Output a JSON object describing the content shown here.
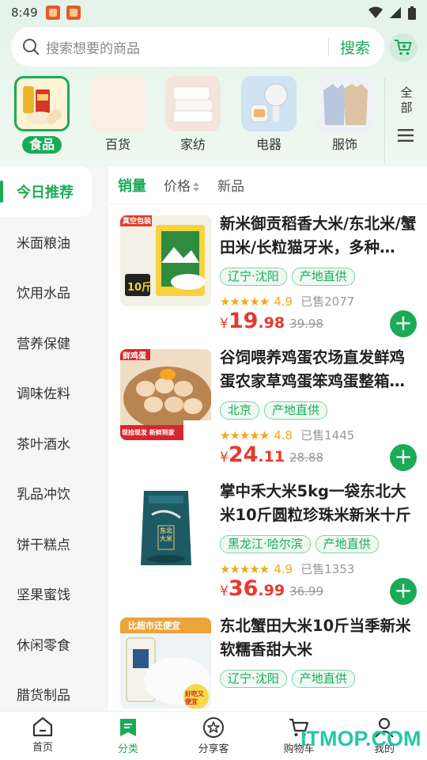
{
  "status_bar": {
    "time": "8:49"
  },
  "search": {
    "placeholder": "搜索想要的商品",
    "button": "搜索"
  },
  "categories": [
    {
      "label": "食品",
      "icon": "food-icon",
      "active": true
    },
    {
      "label": "百货",
      "icon": "goods-icon"
    },
    {
      "label": "家纺",
      "icon": "textile-icon"
    },
    {
      "label": "电器",
      "icon": "appliance-icon"
    },
    {
      "label": "服饰",
      "icon": "clothing-icon"
    }
  ],
  "category_all_label": "全部",
  "sidebar": {
    "items": [
      "今日推荐",
      "米面粮油",
      "饮用水品",
      "营养保健",
      "调味佐料",
      "茶叶酒水",
      "乳品冲饮",
      "饼干糕点",
      "坚果蜜饯",
      "休闲零食",
      "腊货制品"
    ],
    "active_index": 0
  },
  "sort_bar": {
    "items": [
      "销量",
      "价格",
      "新品"
    ],
    "active_index": 0
  },
  "products": [
    {
      "title": "新米御贡稻香大米/东北米/蟹田米/长粒猫牙米，多种…",
      "tags": [
        "辽宁·沈阳",
        "产地直供"
      ],
      "stars": "★★★★★",
      "rating": "4.9",
      "sold": "已售2077",
      "currency": "¥",
      "price_int": "19",
      "price_dec": ".98",
      "old_price": "39.98",
      "img_badge": "真空包装",
      "img_text": "10斤"
    },
    {
      "title": "谷饲喂养鸡蛋农场直发鲜鸡蛋农家草鸡蛋笨鸡蛋整箱…",
      "tags": [
        "北京",
        "产地直供"
      ],
      "stars": "★★★★★",
      "rating": "4.8",
      "sold": "已售1445",
      "currency": "¥",
      "price_int": "24",
      "price_dec": ".11",
      "old_price": "28.88",
      "img_badge": "鲜鸡蛋",
      "img_text": "现捡现发 新鲜到家"
    },
    {
      "title": "掌中禾大米5kg一袋东北大米10斤圆粒珍珠米新米十斤",
      "tags": [
        "黑龙江·哈尔滨",
        "产地直供"
      ],
      "stars": "★★★★★",
      "rating": "4.9",
      "sold": "已售1353",
      "currency": "¥",
      "price_int": "36",
      "price_dec": ".99",
      "old_price": "36.99",
      "img_badge": "",
      "img_text": "东北大米"
    },
    {
      "title": "东北蟹田大米10斤当季新米软糯香甜大米",
      "tags": [
        "辽宁·沈阳",
        "产地直供"
      ],
      "img_badge": "比超市还便宜",
      "img_text": "好吃又便宜"
    }
  ],
  "bottom_nav": [
    {
      "label": "首页",
      "icon": "home-icon"
    },
    {
      "label": "分类",
      "icon": "category-icon",
      "active": true
    },
    {
      "label": "分享客",
      "icon": "share-star-icon"
    },
    {
      "label": "购物车",
      "icon": "cart-icon"
    },
    {
      "label": "我的",
      "icon": "profile-icon"
    }
  ],
  "watermark": "ITMOP.COM",
  "colors": {
    "accent": "#1aab57",
    "price": "#e8392d",
    "star": "#f2a81d",
    "header_bg": "#e5f4ea"
  }
}
